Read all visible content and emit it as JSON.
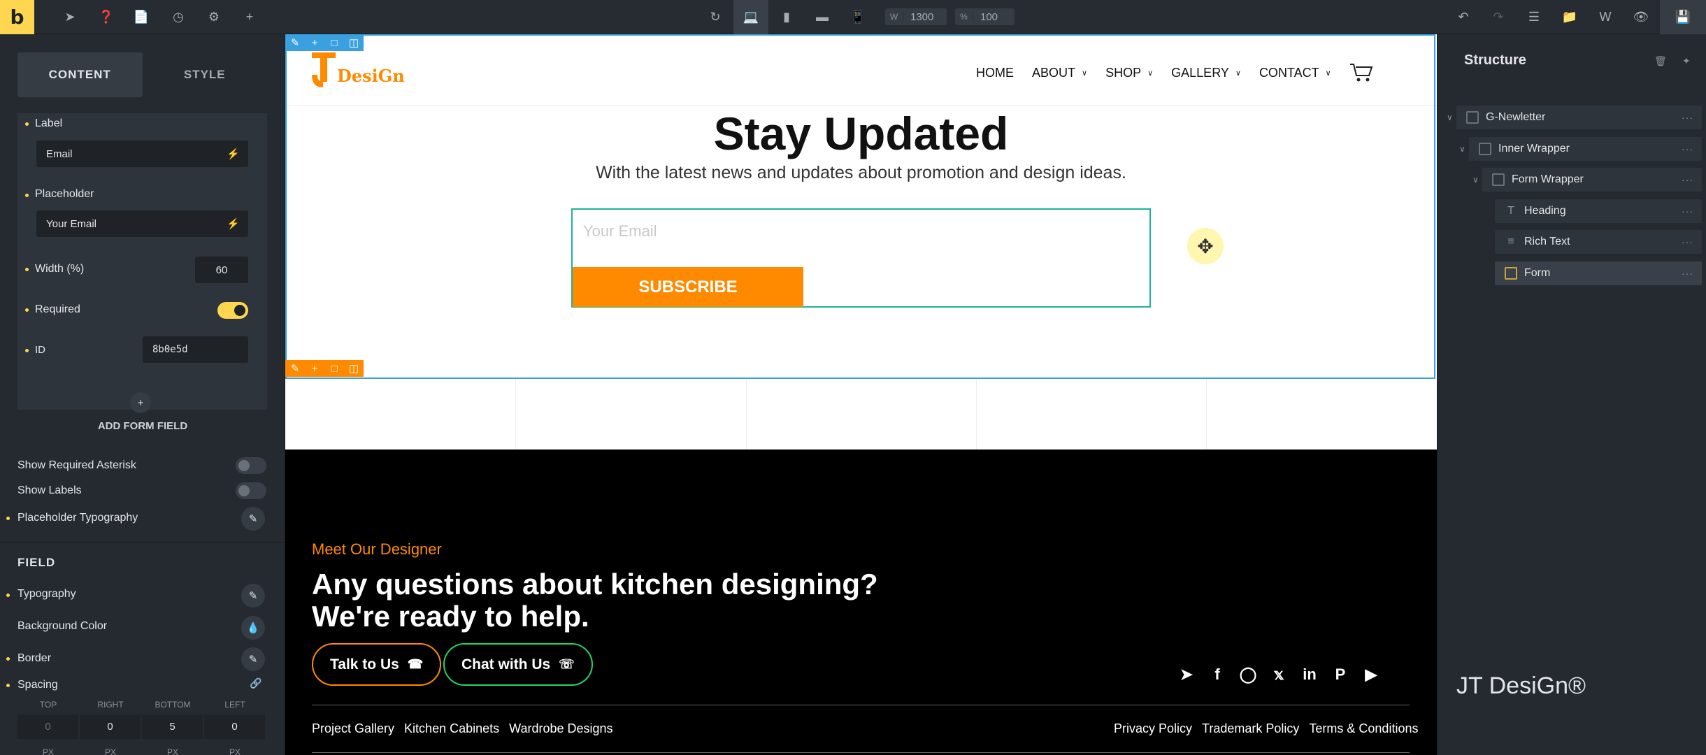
{
  "topbar": {
    "brand_letter": "b",
    "width_label": "W",
    "width_value": "1300",
    "zoom_label": "%",
    "zoom_value": "100"
  },
  "left_panel": {
    "tabs": [
      "CONTENT",
      "STYLE"
    ],
    "label_title": "Label",
    "label_value": "Email",
    "placeholder_title": "Placeholder",
    "placeholder_value": "Your Email",
    "width_title": "Width (%)",
    "width_value": "60",
    "required_title": "Required",
    "id_title": "ID",
    "id_value": "8b0e5d",
    "add_field": "ADD FORM FIELD",
    "show_required": "Show Required Asterisk",
    "show_labels": "Show Labels",
    "placeholder_typo": "Placeholder Typography",
    "field_section": "FIELD",
    "typography": "Typography",
    "bg_color": "Background Color",
    "border": "Border",
    "spacing": "Spacing",
    "spacing_heads": [
      "TOP",
      "RIGHT",
      "BOTTOM",
      "LEFT"
    ],
    "spacing_values": [
      "0",
      "0",
      "5",
      "0"
    ],
    "spacing_units": [
      "PX",
      "PX",
      "PX",
      "PX"
    ]
  },
  "site": {
    "logo_text": "DesiGn",
    "nav": [
      "HOME",
      "ABOUT",
      "SHOP",
      "GALLERY",
      "CONTACT"
    ],
    "heading": "Stay Updated",
    "subheading": "With the latest news and updates about promotion and design ideas.",
    "email_placeholder": "Your Email",
    "subscribe": "SUBSCRIBE",
    "meet": "Meet Our Designer",
    "question_line1": "Any questions about kitchen designing?",
    "question_line2": "We're ready to help.",
    "talk": "Talk to Us",
    "chat": "Chat with Us",
    "footer_links_left": [
      "Project Gallery",
      "Kitchen Cabinets",
      "Wardrobe Designs"
    ],
    "footer_links_right": [
      "Privacy Policy",
      "Trademark Policy",
      "Terms & Conditions"
    ]
  },
  "structure": {
    "title": "Structure",
    "items": [
      "G-Newletter",
      "Inner Wrapper",
      "Form Wrapper",
      "Heading",
      "Rich Text",
      "Form"
    ]
  },
  "watermark": "JT DesiGn®",
  "colors": {
    "accent": "#ffd64f",
    "brand_orange": "#ff8a00",
    "form_border": "#1fb39a",
    "select_outline": "#3aa0e0"
  }
}
